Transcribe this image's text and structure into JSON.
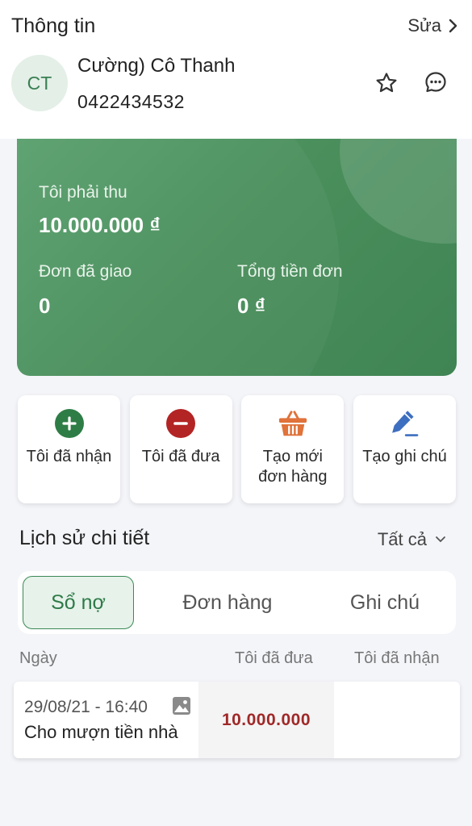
{
  "header": {
    "title": "Thông tin",
    "edit_label": "Sửa",
    "avatar_initials": "CT",
    "contact_name": "Cường) Cô Thanh",
    "contact_phone": "0422434532"
  },
  "summary": {
    "receivable_label": "Tôi phải thu",
    "receivable_value": "10.000.000 ₫",
    "delivered_label": "Đơn đã giao",
    "delivered_value": "0",
    "order_total_label": "Tổng tiền đơn",
    "order_total_value": "0 ₫"
  },
  "actions": [
    {
      "label": "Tôi đã nhận",
      "icon": "plus-circle-icon",
      "color": "#2e7d46"
    },
    {
      "label": "Tôi đã đưa",
      "icon": "minus-circle-icon",
      "color": "#b32424"
    },
    {
      "label": "Tạo mới đơn hàng",
      "icon": "basket-icon",
      "color": "#e0723a"
    },
    {
      "label": "Tạo ghi chú",
      "icon": "pencil-icon",
      "color": "#3d6fc0"
    }
  ],
  "history": {
    "title": "Lịch sử chi tiết",
    "filter_label": "Tất cả",
    "tabs": [
      "Sổ nợ",
      "Đơn hàng",
      "Ghi chú"
    ],
    "active_tab": "Sổ nợ",
    "columns": [
      "Ngày",
      "Tôi đã đưa",
      "Tôi đã nhận"
    ],
    "rows": [
      {
        "date": "29/08/21 - 16:40",
        "note": "Cho mượn tiền nhà",
        "given": "10.000.000",
        "received": ""
      }
    ]
  },
  "colors": {
    "brand_green": "#3f8453",
    "debt_red": "#a02828"
  }
}
